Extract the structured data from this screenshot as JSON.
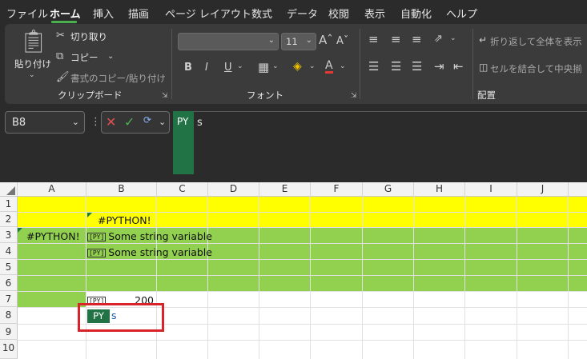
{
  "menu": {
    "items": [
      "ファイル",
      "ホーム",
      "挿入",
      "描画",
      "ページ レイアウト",
      "数式",
      "データ",
      "校閲",
      "表示",
      "自動化",
      "ヘルプ"
    ],
    "active": "ホーム"
  },
  "ribbon": {
    "clipboard": {
      "paste": "貼り付け",
      "cut": "切り取り",
      "copy": "コピー",
      "format_painter": "書式のコピー/貼り付け",
      "label": "クリップボード"
    },
    "font": {
      "size": "11",
      "label": "フォント",
      "bold": "B",
      "italic": "I",
      "underline": "U"
    },
    "alignment": {
      "wrap_text": "折り返して全体を表示",
      "merge_center": "セルを結合して中央揃",
      "label": "配置"
    }
  },
  "formula_bar": {
    "name_box": "B8",
    "badge": "PY",
    "formula": "s"
  },
  "sheet": {
    "columns": [
      "A",
      "B",
      "C",
      "D",
      "E",
      "F",
      "G",
      "H",
      "I",
      "J"
    ],
    "rows": [
      "1",
      "2",
      "3",
      "4",
      "5",
      "6",
      "7",
      "8",
      "9",
      "10"
    ],
    "cells": {
      "B2": "#PYTHON!",
      "A3": "#PYTHON!",
      "B3": "Some string variable",
      "B4": "Some string variable",
      "B7": "200"
    },
    "py_icon": "[PY]",
    "edit_cell": {
      "badge": "PY",
      "text": "s"
    },
    "colors": {
      "yellow_fill": "#ffff00",
      "green_fill": "#92d050",
      "python_green": "#217346",
      "highlight_red": "#d9232a"
    }
  }
}
